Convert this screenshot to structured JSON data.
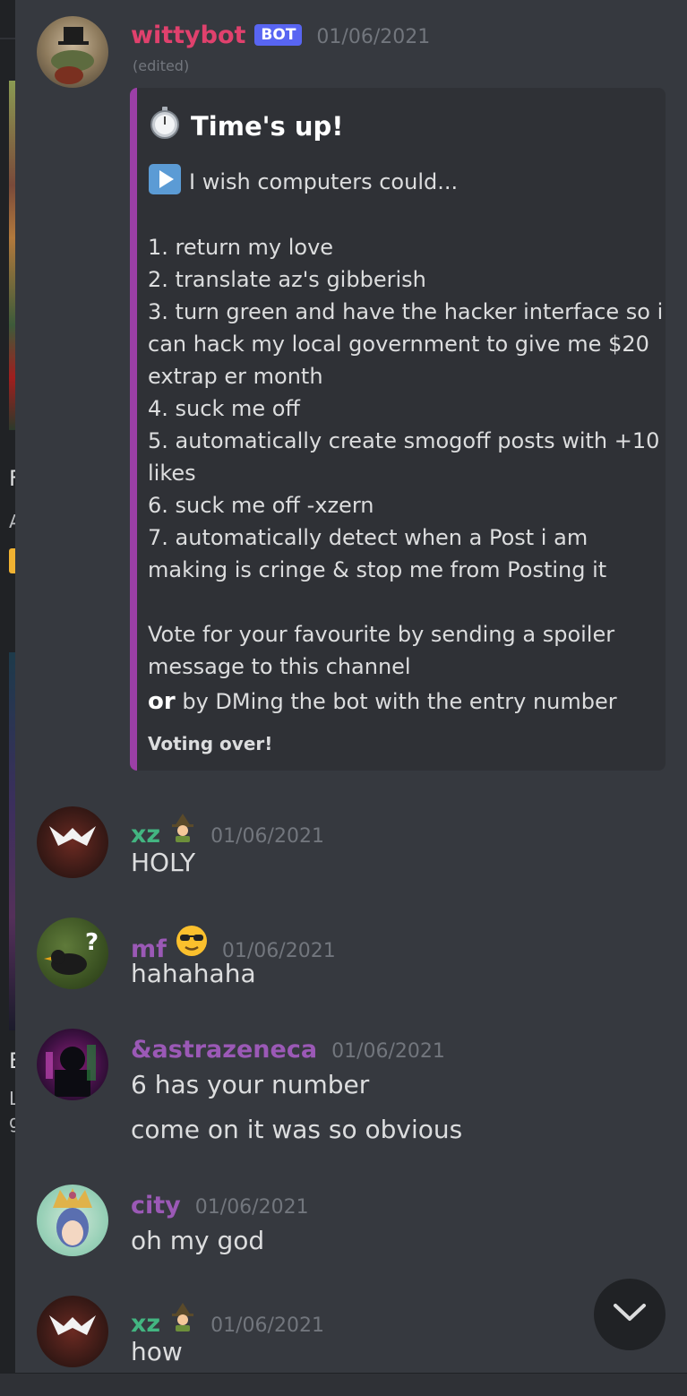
{
  "messages": [
    {
      "author": "wittybot",
      "author_color": "#e0416d",
      "badge": "BOT",
      "timestamp": "01/06/2021",
      "edited": "(edited)",
      "embed": {
        "accent_color": "#9b3fa6",
        "title": "Time's up!",
        "title_icon": "stopwatch-icon",
        "prompt_icon": "play-button-icon",
        "prompt": "I wish computers could...",
        "entries": [
          "1. return my love",
          "2. translate az's gibberish",
          "3. turn green and have the hacker interface so i",
          "can hack my local government to give me $20",
          "extrap er month",
          "4. suck me off",
          "5. automatically create smogoff posts with +10",
          "likes",
          "6. suck me off -xzern",
          "7. automatically detect when a Post i am",
          "making is cringe & stop me from Posting it"
        ],
        "vote_line1": "Vote for your favourite by sending a spoiler",
        "vote_line2": "message to this channel",
        "or_label": "or",
        "vote_line3": "by DMing the bot with the entry number",
        "footer": "Voting over!"
      }
    },
    {
      "author": "xz",
      "author_color": "#43b581",
      "emoji_icon": "mage-emoji-icon",
      "timestamp": "01/06/2021",
      "lines": [
        "HOLY"
      ]
    },
    {
      "author": "mf",
      "author_color": "#9b59b6",
      "emoji_icon": "sunglasses-emoji-icon",
      "timestamp": "01/06/2021",
      "lines": [
        "hahahaha"
      ]
    },
    {
      "author": "&astrazeneca",
      "author_color": "#9b59b6",
      "timestamp": "01/06/2021",
      "lines": [
        "6 has your number",
        "come on it was so obvious"
      ]
    },
    {
      "author": "city",
      "author_color": "#9b59b6",
      "timestamp": "01/06/2021",
      "lines": [
        "oh my god"
      ]
    },
    {
      "author": "xz",
      "author_color": "#43b581",
      "emoji_icon": "mage-emoji-icon",
      "timestamp": "01/06/2021",
      "lines": [
        "how"
      ]
    }
  ],
  "scroll_button_icon": "chevron-down-icon",
  "left_panel": {
    "letters": [
      "F",
      "A",
      "E",
      "L",
      "g"
    ]
  }
}
